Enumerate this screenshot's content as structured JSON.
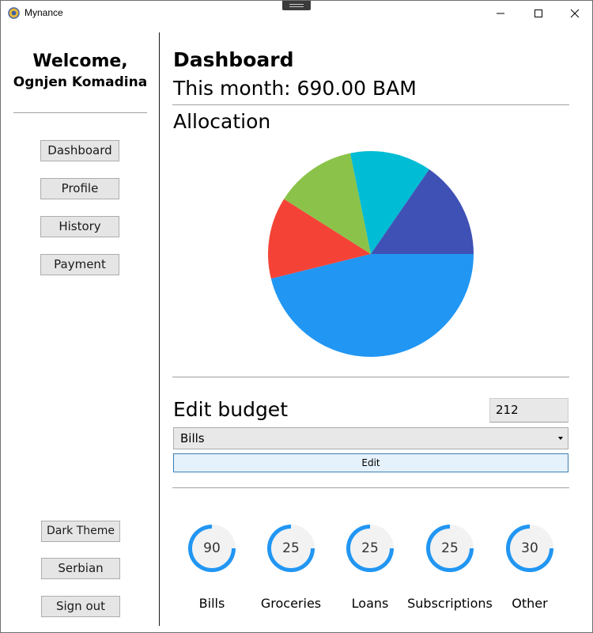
{
  "window": {
    "title": "Mynance"
  },
  "sidebar": {
    "welcome": "Welcome,",
    "user_name": "Ognjen Komadina",
    "nav": [
      "Dashboard",
      "Profile",
      "History",
      "Payment"
    ],
    "dark_theme": "Dark Theme",
    "language": "Serbian",
    "sign_out": "Sign out"
  },
  "main": {
    "title": "Dashboard",
    "this_month": "This month: 690.00 BAM",
    "allocation_title": "Allocation",
    "edit_title": "Edit budget",
    "amount_value": "212",
    "category_selected": "Bills",
    "edit_button": "Edit"
  },
  "chart_data": {
    "type": "pie",
    "values": [
      90,
      25,
      25,
      25,
      30
    ],
    "colors": [
      "#2196F3",
      "#F44336",
      "#8BC34A",
      "#00BCD4",
      "#3F51B5"
    ]
  },
  "budgets": [
    {
      "label": "Bills",
      "value": "90",
      "fraction": 0.75
    },
    {
      "label": "Groceries",
      "value": "25",
      "fraction": 0.75
    },
    {
      "label": "Loans",
      "value": "25",
      "fraction": 0.75
    },
    {
      "label": "Subscriptions",
      "value": "25",
      "fraction": 0.75
    },
    {
      "label": "Other",
      "value": "30",
      "fraction": 0.75
    }
  ],
  "colors": {
    "accent": "#2196F3",
    "gauge_track": "#f2f2f2"
  }
}
